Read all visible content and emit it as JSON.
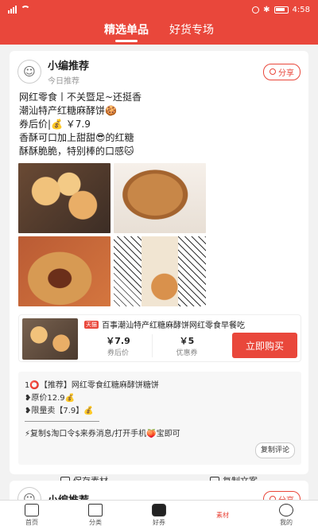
{
  "statusbar": {
    "time": "4:58"
  },
  "header": {
    "tabs": [
      {
        "label": "精选单品"
      },
      {
        "label": "好货专场"
      }
    ]
  },
  "post": {
    "author": "小编推荐",
    "subtitle": "今日推荐",
    "share_label": "分享",
    "lines": [
      "网红零食丨不关暨足~还挺香",
      "潮汕特产红糖麻酵饼🍪",
      "券后价|💰 ￥7.9",
      "香酥可口加上甜甜😎的红糖",
      "酥酥脆脆，特别棒的口感🐱"
    ],
    "product": {
      "tag": "天猫",
      "title": "百事潮汕特产红糖麻酵饼网红零食早餐吃",
      "coupon_price": "￥7.9",
      "coupon_price_label": "券后价",
      "discount": "￥5",
      "discount_label": "优惠券",
      "buy_label": "立即购买"
    },
    "copy": {
      "lines": [
        "1⭕【推荐】网红零食红糖麻酵饼糖饼",
        "❥原价12.9💰",
        "❥限量卖【7.9】💰",
        "⚡复制$淘口令$来券消息/打开手机🍑宝即可"
      ],
      "comment_btn": "复制评论"
    },
    "actions": {
      "save": "保存素材",
      "copy": "复制文案"
    }
  },
  "post2": {
    "author": "小编推荐",
    "share_label": "分享"
  },
  "nav": [
    {
      "label": "首页",
      "icon": "home-icon"
    },
    {
      "label": "分类",
      "icon": "category-icon"
    },
    {
      "label": "好券",
      "icon": "coupon-icon"
    },
    {
      "label": "素材",
      "icon": "material-icon",
      "active": true
    },
    {
      "label": "我的",
      "icon": "profile-icon"
    }
  ],
  "colors": {
    "accent": "#e9473b"
  }
}
